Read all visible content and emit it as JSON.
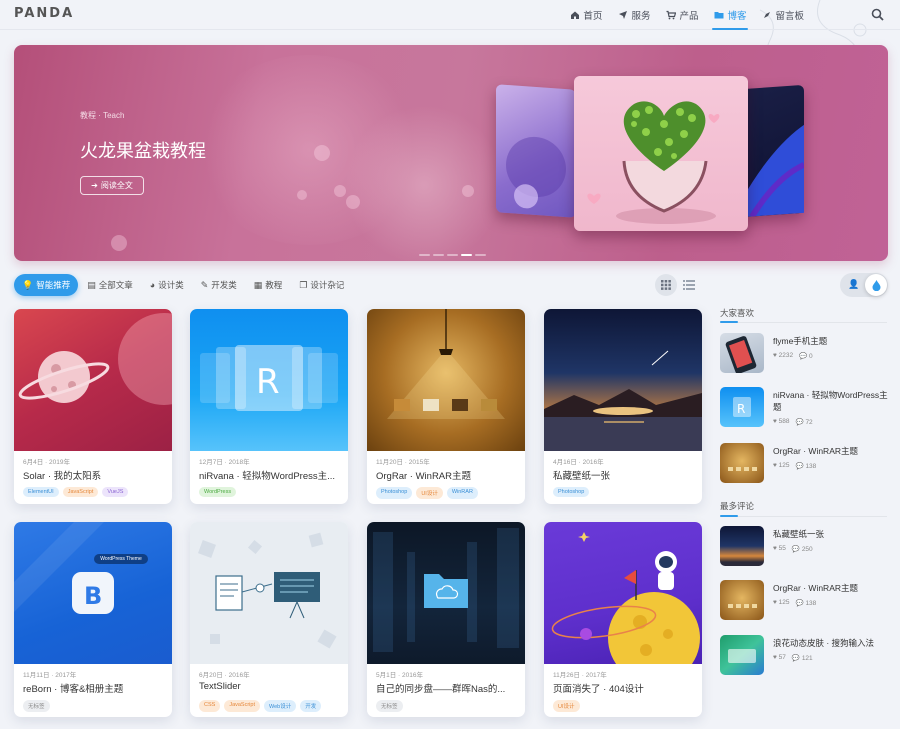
{
  "header": {
    "logo": "PANDA",
    "nav": [
      {
        "icon": "home-icon",
        "label": "首页"
      },
      {
        "icon": "plane-icon",
        "label": "服务"
      },
      {
        "icon": "cart-icon",
        "label": "产品"
      },
      {
        "icon": "folder-icon",
        "label": "博客",
        "active": true
      },
      {
        "icon": "compass-icon",
        "label": "留言板"
      }
    ]
  },
  "banner": {
    "category": "教程 · Teach",
    "title": "火龙果盆栽教程",
    "button_label": "阅读全文",
    "slide_count": 5,
    "active_slide": 4
  },
  "tabs": [
    {
      "icon": "bulb-icon",
      "label": "智能推荐",
      "active": true
    },
    {
      "icon": "book-icon",
      "label": "全部文章"
    },
    {
      "icon": "palette-icon",
      "label": "设计类"
    },
    {
      "icon": "wrench-icon",
      "label": "开发类"
    },
    {
      "icon": "slides-icon",
      "label": "教程"
    },
    {
      "icon": "clone-icon",
      "label": "设计杂记"
    }
  ],
  "cards": [
    {
      "date": "6月4日 · 2019年",
      "title": "Solar · 我的太阳系",
      "tags": [
        {
          "label": "ElementUI",
          "color": "blue"
        },
        {
          "label": "JavaScript",
          "color": "orange"
        },
        {
          "label": "VueJS",
          "color": "purple"
        }
      ]
    },
    {
      "date": "12月7日 · 2018年",
      "title": "niRvana · 轻拟物WordPress主...",
      "tags": [
        {
          "label": "WordPress",
          "color": "green"
        }
      ]
    },
    {
      "date": "11月20日 · 2015年",
      "title": "OrgRar · WinRAR主题",
      "tags": [
        {
          "label": "Photoshop",
          "color": "blue"
        },
        {
          "label": "UI设计",
          "color": "orange"
        },
        {
          "label": "WinRAR",
          "color": "blue"
        }
      ]
    },
    {
      "date": "4月16日 · 2016年",
      "title": "私藏壁纸一张",
      "tags": [
        {
          "label": "Photoshop",
          "color": "blue"
        }
      ]
    },
    {
      "date": "11月11日 · 2017年",
      "title": "reBorn · 博客&相册主题",
      "tags": [
        {
          "label": "无标签",
          "color": "gray"
        }
      ],
      "badge": "WordPress Theme"
    },
    {
      "date": "6月20日 · 2016年",
      "title": "TextSlider",
      "tags": [
        {
          "label": "CSS",
          "color": "orange"
        },
        {
          "label": "JavaScript",
          "color": "orange"
        },
        {
          "label": "Web设计",
          "color": "blue"
        },
        {
          "label": "开发",
          "color": "blue"
        }
      ]
    },
    {
      "date": "5月1日 · 2016年",
      "title": "自己的同步盘——群晖Nas的...",
      "tags": [
        {
          "label": "无标签",
          "color": "gray"
        }
      ]
    },
    {
      "date": "11月26日 · 2017年",
      "title": "页面消失了 · 404设计",
      "tags": [
        {
          "label": "UI设计",
          "color": "orange"
        }
      ]
    }
  ],
  "sidebar": {
    "popular_title": "大家喜欢",
    "popular": [
      {
        "title": "flyme手机主题",
        "likes": "2232",
        "comments": "0"
      },
      {
        "title": "niRvana · 轻拟物WordPress主题",
        "likes": "588",
        "comments": "72"
      },
      {
        "title": "OrgRar · WinRAR主题",
        "likes": "125",
        "comments": "138"
      }
    ],
    "comments_title": "最多评论",
    "most_comments": [
      {
        "title": "私藏壁纸一张",
        "likes": "55",
        "comments": "250"
      },
      {
        "title": "OrgRar · WinRAR主题",
        "likes": "125",
        "comments": "138"
      },
      {
        "title": "浪花动态皮肤 · 搜狗输入法",
        "likes": "57",
        "comments": "121"
      }
    ]
  },
  "colors": {
    "accent": "#2f9bea",
    "background": "#f1f3f8"
  }
}
